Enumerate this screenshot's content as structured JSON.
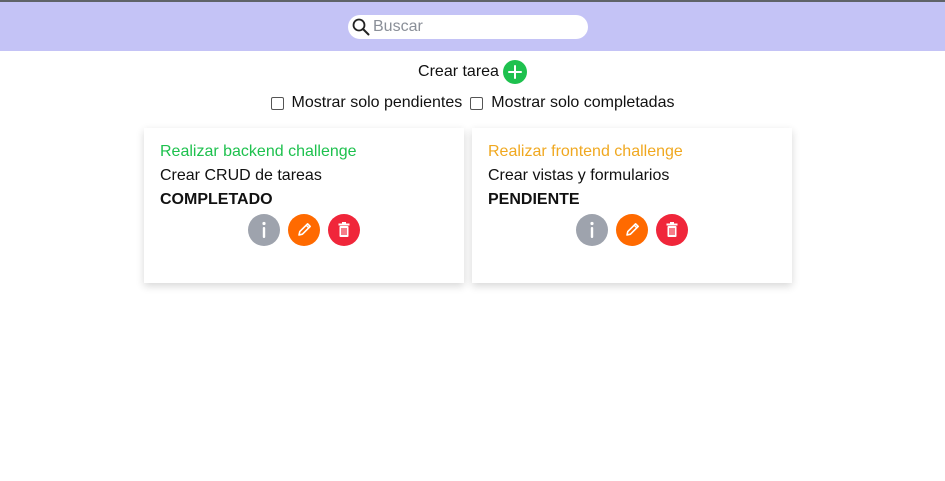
{
  "search": {
    "placeholder": "Buscar",
    "value": "",
    "icon": "search-icon"
  },
  "create": {
    "label": "Crear tarea",
    "icon": "plus-icon",
    "color": "#1ec14e"
  },
  "filters": [
    {
      "label": "Mostrar solo pendientes",
      "checked": false
    },
    {
      "label": "Mostrar solo completadas",
      "checked": false
    }
  ],
  "colors": {
    "header_bg": "#c4c3f6",
    "completed_title": "#1ec14e",
    "pending_title": "#f0a820",
    "info_button": "#9ea3ad",
    "edit_button": "#ff6a00",
    "delete_button": "#f0263a"
  },
  "tasks": [
    {
      "title": "Realizar backend challenge",
      "description": "Crear CRUD de tareas",
      "status": "COMPLETADO",
      "title_color": "#1ec14e"
    },
    {
      "title": "Realizar frontend challenge",
      "description": "Crear vistas y formularios",
      "status": "PENDIENTE",
      "title_color": "#f0a820"
    }
  ],
  "actions": {
    "info_icon": "info-icon",
    "edit_icon": "pencil-icon",
    "delete_icon": "trash-icon"
  }
}
